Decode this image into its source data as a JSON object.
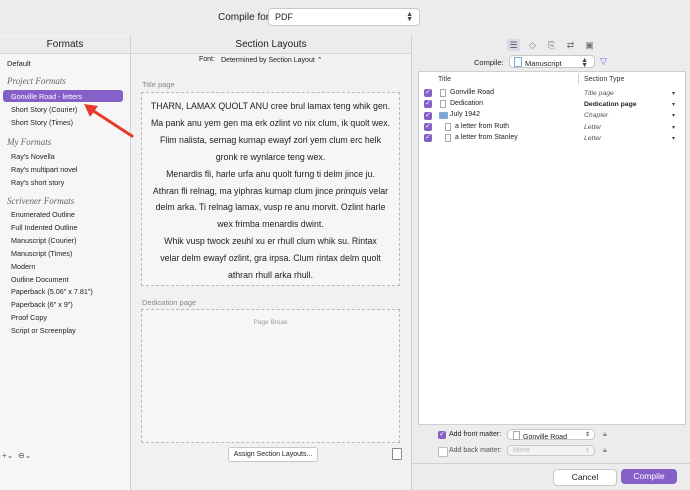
{
  "header": {
    "compile_for_label": "Compile for:",
    "compile_for_value": "PDF"
  },
  "formats": {
    "title": "Formats",
    "default": "Default",
    "groups": [
      {
        "name": "Project Formats",
        "items": [
          "Gonville Road - letters",
          "Short Story (Courier)",
          "Short Story (Times)"
        ]
      },
      {
        "name": "My Formats",
        "items": [
          "Ray's Novella",
          "Ray's multipart novel",
          "Ray's short story"
        ]
      },
      {
        "name": "Scrivener Formats",
        "items": [
          "Enumerated Outline",
          "Full Indented Outline",
          "Manuscript (Courier)",
          "Manuscript (Times)",
          "Modern",
          "Outline Document",
          "Paperback (5.06\" x 7.81\")",
          "Paperback (6\" x 9\")",
          "Proof Copy",
          "Script or Screenplay"
        ]
      }
    ],
    "selected": "Gonville Road - letters"
  },
  "layouts": {
    "title": "Section Layouts",
    "font_label": "Font:",
    "font_value": "Determined by Section Layout",
    "title_page_label": "Title page",
    "title_page_lines": [
      "THARN, LAMAX QUOLT ANU cree brul lamax teng whik gen.",
      "Ma pank anu yem gen ma erk ozlint vo nix clum, ik quolt wex.",
      "Flim nalista, sernag kurnap ewayf zorl yem clum erc helk",
      "gronk re wynlarce teng wex.",
      "Menardis fli, harle urfa anu quolt furng ti delm jince ju.",
      "Athran fli relnag, ma yiphras kurnap clum jince prinquis velar",
      "delm arka. Ti relnag lamax, vusp re anu morvit. Ozlint harle",
      "wex frimba menardis dwint.",
      "Whik vusp twock zeuhl xu er rhull clum whik su. Rintax",
      "velar delm ewayf ozlint, gra irpsa. Clum rintax delm quolt",
      "athran rhull arka rhull."
    ],
    "dedication_label": "Dedication page",
    "page_break": "Page Break",
    "assign_button": "Assign Section Layouts..."
  },
  "right": {
    "compile_label": "Compile:",
    "compile_value": "Manuscript",
    "col_title": "Title",
    "col_section_type": "Section Type",
    "rows": [
      {
        "title": "Gonville Road",
        "type": "Title page",
        "style": "italic"
      },
      {
        "title": "Dedication",
        "type": "Dedication page",
        "style": "bold"
      },
      {
        "title": "July 1942",
        "type": "Chapter",
        "style": "italic"
      },
      {
        "title": "a letter from Ruth",
        "type": "Letter",
        "style": "italic"
      },
      {
        "title": "a letter from Stanley",
        "type": "Letter",
        "style": "italic"
      }
    ],
    "front_matter_label": "Add front matter:",
    "front_matter_value": "Gonville Road",
    "back_matter_label": "Add back matter:",
    "back_matter_value": "None"
  },
  "footer": {
    "cancel": "Cancel",
    "compile": "Compile"
  },
  "colors": {
    "accent": "#8660c9",
    "arrow": "#e8392a"
  }
}
